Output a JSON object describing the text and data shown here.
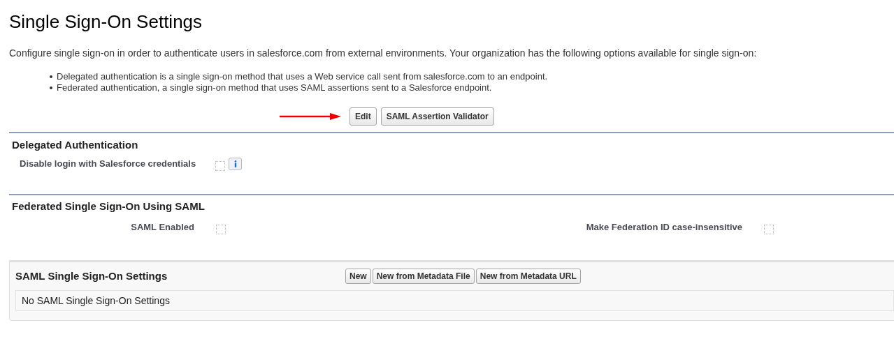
{
  "title": "Single Sign-On Settings",
  "description": "Configure single sign-on in order to authenticate users in salesforce.com from external environments. Your organization has the following options available for single sign-on:",
  "options": [
    "Delegated authentication is a single sign-on method that uses a Web service call sent from salesforce.com to an endpoint.",
    "Federated authentication, a single sign-on method that uses SAML assertions sent to a Salesforce endpoint."
  ],
  "buttons": [
    "Edit",
    "SAML Assertion Validator"
  ],
  "delegated": {
    "heading": "Delegated Authentication",
    "fields": [
      {
        "label": "Disable login with Salesforce credentials",
        "checked": false
      }
    ]
  },
  "federated": {
    "heading": "Federated Single Sign-On Using SAML",
    "fields": [
      {
        "label": "SAML Enabled",
        "checked": false
      },
      {
        "label": "Make Federation ID case-insensitive",
        "checked": false
      }
    ]
  },
  "saml_settings": {
    "heading": "SAML Single Sign-On Settings",
    "buttons": [
      "New",
      "New from Metadata File",
      "New from Metadata URL"
    ],
    "empty_message": "No SAML Single Sign-On Settings"
  }
}
